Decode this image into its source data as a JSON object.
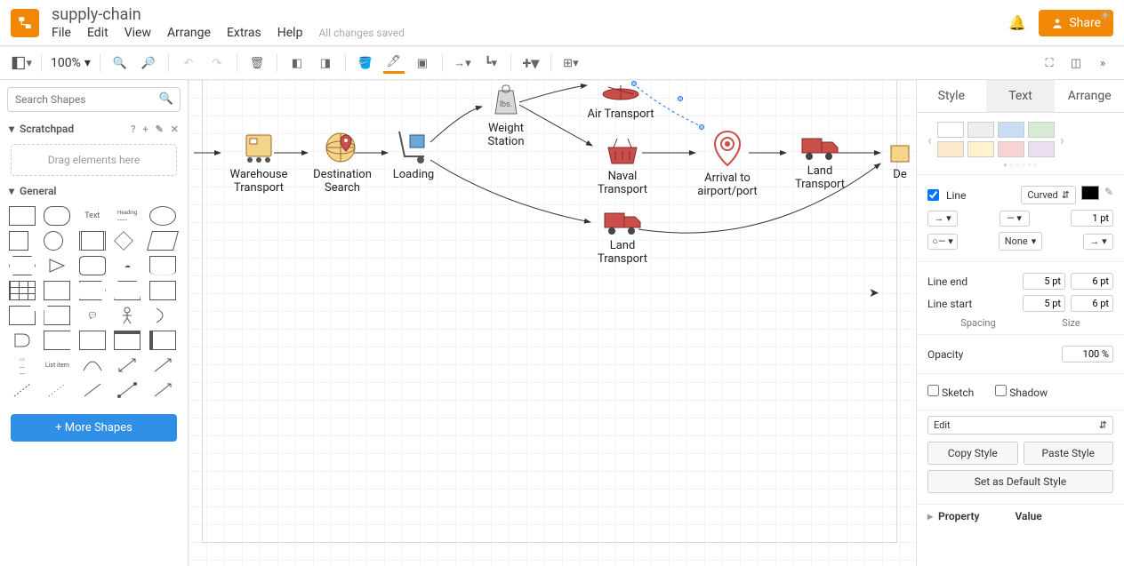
{
  "doc_title": "supply-chain",
  "menus": {
    "file": "File",
    "edit": "Edit",
    "view": "View",
    "arrange": "Arrange",
    "extras": "Extras",
    "help": "Help"
  },
  "saved_status": "All changes saved",
  "share": "Share",
  "zoom": "100%",
  "search_placeholder": "Search Shapes",
  "scratchpad": {
    "title": "Scratchpad",
    "hint": "Drag elements here"
  },
  "general_title": "General",
  "more_shapes": "More Shapes",
  "nodes": {
    "warehouse": "Warehouse Transport",
    "destination": "Destination Search",
    "loading": "Loading",
    "weight": "Weight Station",
    "air": "Air Transport",
    "naval": "Naval Transport",
    "land1": "Land Transport",
    "arrival": "Arrival to airport/port",
    "land2": "Land Transport",
    "delivery": "De"
  },
  "right": {
    "tabs": {
      "style": "Style",
      "text": "Text",
      "arrange": "Arrange"
    },
    "line_label": "Line",
    "line_style": "Curved",
    "line_width": "1 pt",
    "waypoints": "None",
    "line_end_label": "Line end",
    "line_start_label": "Line start",
    "end_spacing": "5 pt",
    "end_size": "6 pt",
    "start_spacing": "5 pt",
    "start_size": "6 pt",
    "spacing_label": "Spacing",
    "size_label": "Size",
    "opacity_label": "Opacity",
    "opacity": "100 %",
    "sketch": "Sketch",
    "shadow": "Shadow",
    "edit": "Edit",
    "copy_style": "Copy Style",
    "paste_style": "Paste Style",
    "default_style": "Set as Default Style",
    "property": "Property",
    "value": "Value"
  },
  "colors": {
    "accent": "#f08705",
    "swatches_top": [
      "#ffffff",
      "#e8e8e8",
      "#c9ddf5",
      "#d6ecd2"
    ],
    "swatches_bottom": [
      "#fde9cd",
      "#fff2cc",
      "#f7d4d4",
      "#e9dff1"
    ]
  }
}
